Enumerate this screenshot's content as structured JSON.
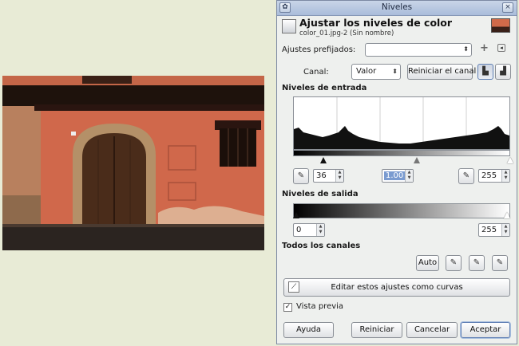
{
  "dialog": {
    "window_title": "Niveles",
    "header_title": "Ajustar los niveles de color",
    "header_subtitle": "color_01.jpg-2 (Sin nombre)",
    "presets_label": "Ajustes prefijados:",
    "presets_value": "",
    "channel_label": "Canal:",
    "channel_value": "Valor",
    "reset_channel": "Reiniciar el canal",
    "input_levels": "Niveles de entrada",
    "input_low": "36",
    "input_gamma": "1.00",
    "input_high": "255",
    "output_levels": "Niveles de salida",
    "output_low": "0",
    "output_high": "255",
    "all_channels": "Todos los canales",
    "auto": "Auto",
    "edit_as_curves": "Editar estos ajustes como curvas",
    "preview": "Vista previa",
    "help": "Ayuda",
    "reset": "Reiniciar",
    "cancel": "Cancelar",
    "accept": "Aceptar"
  },
  "controls": {
    "preview_checked": true,
    "channel_options_visible": [
      "Valor"
    ]
  },
  "icons": {
    "add_preset": "plus-icon",
    "preset_menu": "menu-icon",
    "linear_histogram": "linear-histogram-icon",
    "log_histogram": "log-histogram-icon",
    "eyedropper": "eyedropper-icon"
  }
}
